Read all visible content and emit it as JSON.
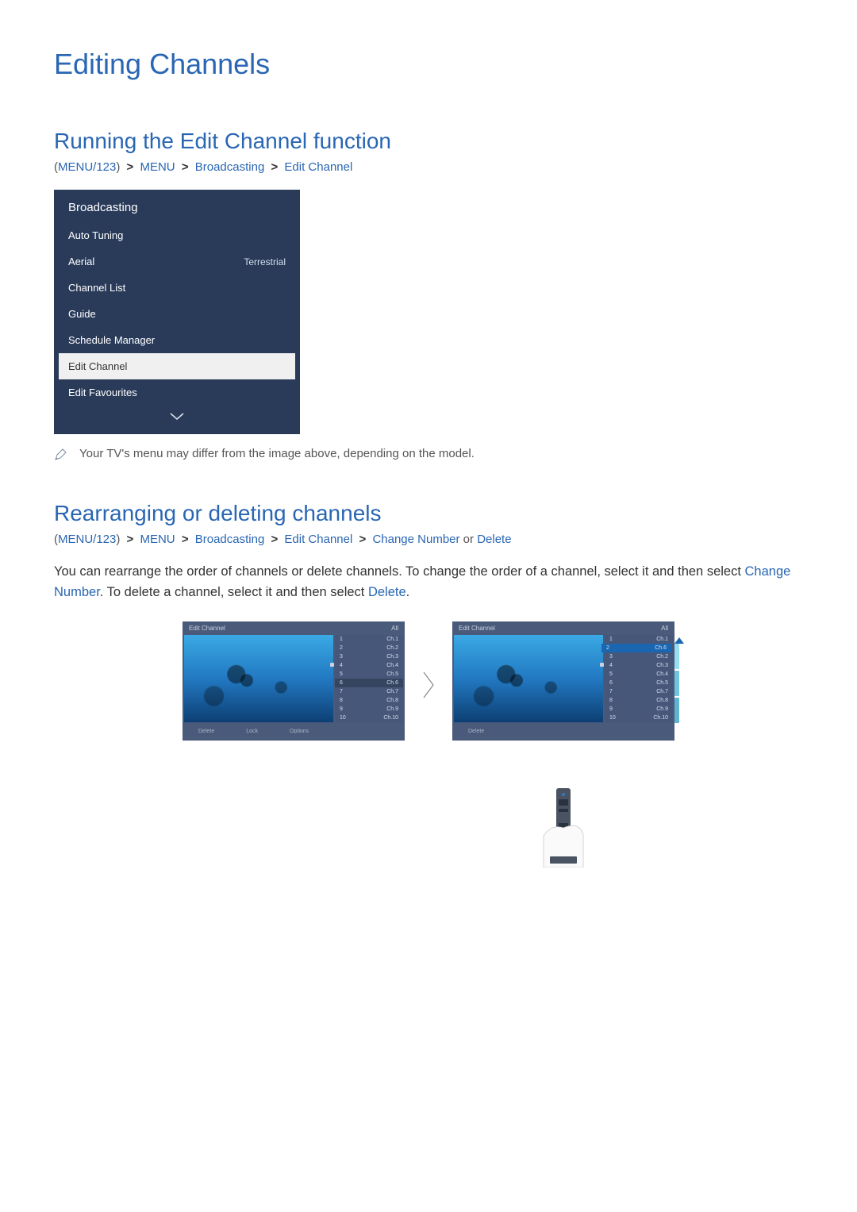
{
  "title": "Editing Channels",
  "section1": {
    "heading": "Running the Edit Channel function",
    "bc": {
      "p_open": "(",
      "menu123": "MENU/123",
      "p_close": ")",
      "menu": "MENU",
      "broadcasting": "Broadcasting",
      "edit_channel": "Edit Channel"
    }
  },
  "menu_panel": {
    "header": "Broadcasting",
    "items": [
      {
        "label": "Auto Tuning",
        "value": ""
      },
      {
        "label": "Aerial",
        "value": "Terrestrial"
      },
      {
        "label": "Channel List",
        "value": ""
      },
      {
        "label": "Guide",
        "value": ""
      },
      {
        "label": "Schedule Manager",
        "value": ""
      },
      {
        "label": "Edit Channel",
        "value": "",
        "selected": true
      },
      {
        "label": "Edit Favourites",
        "value": ""
      }
    ]
  },
  "note": "Your TV's menu may differ from the image above, depending on the model.",
  "section2": {
    "heading": "Rearranging or deleting channels",
    "bc": {
      "p_open": "(",
      "menu123": "MENU/123",
      "p_close": ")",
      "menu": "MENU",
      "broadcasting": "Broadcasting",
      "edit_channel": "Edit Channel",
      "change_number": "Change Number",
      "or": " or ",
      "delete": "Delete"
    },
    "body_pre": "You can rearrange the order of channels or delete channels. To change the order of a channel, select it and then select ",
    "kw1": "Change Number",
    "body_mid": ". To delete a channel, select it and then select ",
    "kw2": "Delete",
    "body_end": "."
  },
  "preview1": {
    "title": "Edit Channel",
    "filter": "All",
    "rows": [
      {
        "n": "1",
        "c": "Ch.1"
      },
      {
        "n": "2",
        "c": "Ch.2"
      },
      {
        "n": "3",
        "c": "Ch.3"
      },
      {
        "n": "4",
        "c": "Ch.4",
        "lock": true
      },
      {
        "n": "5",
        "c": "Ch.5"
      },
      {
        "n": "6",
        "c": "Ch.6",
        "sel": "b"
      },
      {
        "n": "7",
        "c": "Ch.7"
      },
      {
        "n": "8",
        "c": "Ch.8"
      },
      {
        "n": "9",
        "c": "Ch.9"
      },
      {
        "n": "10",
        "c": "Ch.10"
      }
    ],
    "footer": {
      "a": "Delete",
      "b": "Lock",
      "c": "Options"
    }
  },
  "preview2": {
    "title": "Edit Channel",
    "filter": "All",
    "rows": [
      {
        "n": "1",
        "c": "Ch.1"
      },
      {
        "n": "2",
        "c": "Ch.6",
        "moved": true
      },
      {
        "n": "3",
        "c": "Ch.2"
      },
      {
        "n": "4",
        "c": "Ch.3",
        "lock": true
      },
      {
        "n": "5",
        "c": "Ch.4"
      },
      {
        "n": "6",
        "c": "Ch.5"
      },
      {
        "n": "7",
        "c": "Ch.7"
      },
      {
        "n": "8",
        "c": "Ch.8"
      },
      {
        "n": "9",
        "c": "Ch.9"
      },
      {
        "n": "10",
        "c": "Ch.10"
      }
    ],
    "footer": {
      "a": "Delete"
    }
  }
}
